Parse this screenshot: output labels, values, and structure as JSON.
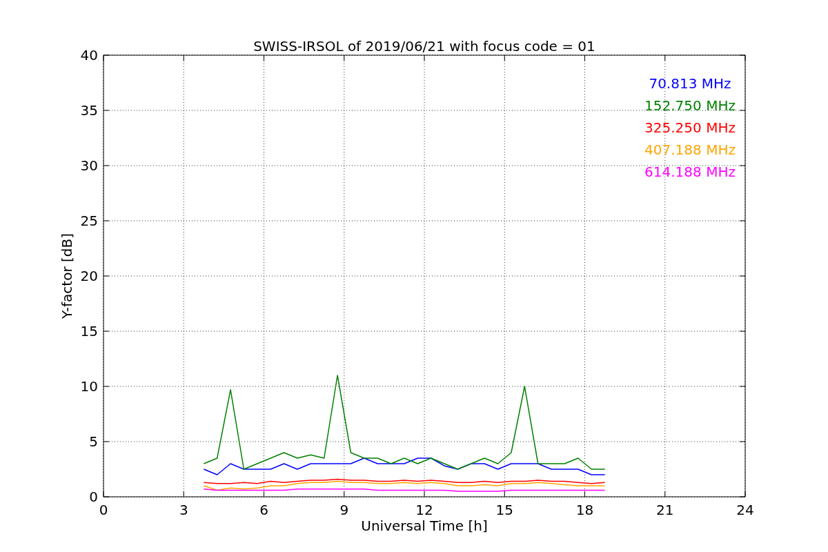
{
  "chart_data": {
    "type": "line",
    "title": "SWISS-IRSOL of 2019/06/21 with focus code = 01",
    "xlabel": "Universal Time [h]",
    "ylabel": "Y-factor [dB]",
    "x": [
      3.75,
      4.25,
      4.75,
      5.25,
      5.75,
      6.25,
      6.75,
      7.25,
      7.75,
      8.25,
      8.75,
      9.25,
      9.75,
      10.25,
      10.75,
      11.25,
      11.75,
      12.25,
      12.75,
      13.25,
      13.75,
      14.25,
      14.75,
      15.25,
      15.75,
      16.25,
      16.75,
      17.25,
      17.75,
      18.25,
      18.75
    ],
    "xlim": [
      0,
      24
    ],
    "ylim": [
      0,
      40
    ],
    "grid": true,
    "xticks": [
      0,
      3,
      6,
      9,
      12,
      15,
      18,
      21,
      24
    ],
    "yticks": [
      0,
      5,
      10,
      15,
      20,
      25,
      30,
      35,
      40
    ],
    "series": [
      {
        "name": "70.813 MHz",
        "color": "#0000ff",
        "values": [
          2.5,
          2.0,
          3.0,
          2.5,
          2.5,
          2.5,
          3.0,
          2.5,
          3.0,
          3.0,
          3.0,
          3.0,
          3.5,
          3.0,
          3.0,
          3.0,
          3.5,
          3.5,
          2.8,
          2.5,
          3.0,
          3.0,
          2.5,
          3.0,
          3.0,
          3.0,
          2.5,
          2.5,
          2.5,
          2.0,
          2.0
        ]
      },
      {
        "name": "152.750 MHz",
        "color": "#008000",
        "values": [
          3.0,
          3.5,
          9.7,
          2.5,
          3.0,
          3.5,
          4.0,
          3.5,
          3.8,
          3.5,
          11.0,
          4.0,
          3.5,
          3.5,
          3.0,
          3.5,
          3.0,
          3.5,
          3.0,
          2.5,
          3.0,
          3.5,
          3.0,
          4.0,
          10.0,
          3.0,
          3.0,
          3.0,
          3.5,
          2.5,
          2.5
        ]
      },
      {
        "name": "325.250 MHz",
        "color": "#ff0000",
        "values": [
          1.3,
          1.2,
          1.2,
          1.3,
          1.2,
          1.4,
          1.3,
          1.4,
          1.5,
          1.5,
          1.6,
          1.5,
          1.5,
          1.4,
          1.4,
          1.5,
          1.4,
          1.5,
          1.4,
          1.3,
          1.3,
          1.4,
          1.3,
          1.4,
          1.4,
          1.5,
          1.4,
          1.4,
          1.3,
          1.2,
          1.3
        ]
      },
      {
        "name": "407.188 MHz",
        "color": "#ffa500",
        "values": [
          1.0,
          0.6,
          0.8,
          0.7,
          0.8,
          1.0,
          1.0,
          1.2,
          1.3,
          1.3,
          1.4,
          1.3,
          1.3,
          1.2,
          1.2,
          1.3,
          1.2,
          1.3,
          1.2,
          1.0,
          1.0,
          1.1,
          1.0,
          1.2,
          1.2,
          1.3,
          1.2,
          1.1,
          1.0,
          1.0,
          1.0
        ]
      },
      {
        "name": "614.188 MHz",
        "color": "#ff00ff",
        "values": [
          0.7,
          0.6,
          0.6,
          0.6,
          0.6,
          0.6,
          0.6,
          0.7,
          0.7,
          0.7,
          0.7,
          0.7,
          0.7,
          0.6,
          0.6,
          0.6,
          0.6,
          0.6,
          0.6,
          0.5,
          0.5,
          0.5,
          0.5,
          0.6,
          0.6,
          0.6,
          0.6,
          0.6,
          0.6,
          0.6,
          0.6
        ]
      }
    ]
  }
}
